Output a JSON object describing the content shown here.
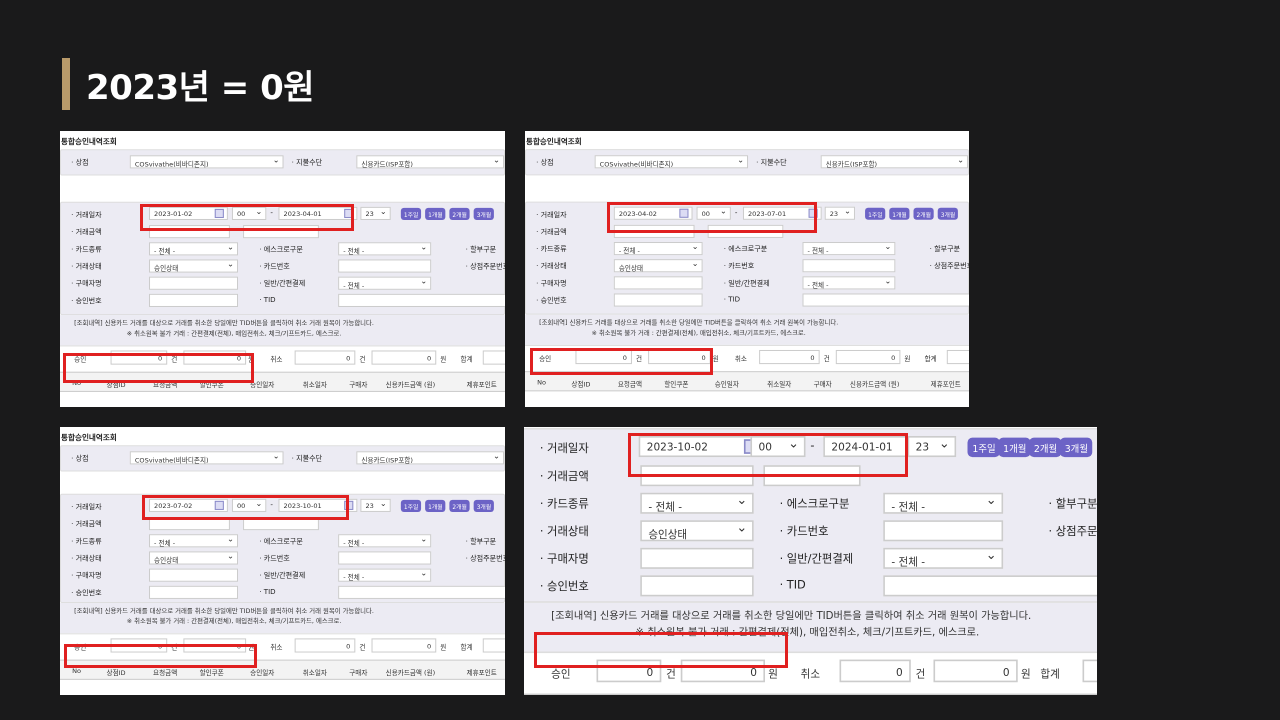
{
  "slide": {
    "title": "2023년 = 0원",
    "accent": "#b89a6a",
    "highlight": "#e02020",
    "button_color": "#6c63c6"
  },
  "form": {
    "screen_title": "통합승인내역조회",
    "store_label": "· 상점",
    "store_value": "COSvivathe(비바디존지)",
    "payment_label": "· 지불수단",
    "payment_value": "신용카드(ISP포함)",
    "date_label": "· 거래일자",
    "amount_label": "· 거래금액",
    "card_type_label": "· 카드종류",
    "card_type_value": "- 전체 -",
    "escrow_label": "· 에스크로구분",
    "escrow_value": "- 전체 -",
    "installment_label": "· 할부구분",
    "status_label": "· 거래상태",
    "status_value": "승인상태",
    "card_no_label": "· 카드번호",
    "store_order_label": "· 상점주문번호",
    "buyer_label": "· 구매자명",
    "simple_pay_label": "· 일반/간편결제",
    "simple_pay_value": "- 전체 -",
    "approval_no_label": "· 승인번호",
    "tid_label": "· TID",
    "range_buttons": [
      "1주일",
      "1개월",
      "2개월",
      "3개월"
    ],
    "notice_line1": "[조회내역]  신용카드 거래를 대상으로 거래를 취소한 당일에만 TID버튼을 클릭하여 취소 거래 원복이 가능합니다.",
    "notice_line2": "※ 취소원복 불가 거래 : 간편결제(전체), 매입전취소, 체크/기프트카드, 에스크로.",
    "approve_label": "승인",
    "cancel_label": "취소",
    "total_label": "합계",
    "count_value": "0",
    "count_unit": "건",
    "amount_value": "0",
    "amount_unit": "원",
    "columns": [
      "No",
      "상점ID",
      "요청금액",
      "할인쿠폰",
      "승인일자",
      "취소일자",
      "구매자",
      "신용카드금액 (원)",
      "제휴포인트"
    ]
  },
  "screens": [
    {
      "start_date": "2023-01-02",
      "start_hour": "00",
      "end_date": "2023-04-01",
      "end_hour": "23"
    },
    {
      "start_date": "2023-04-02",
      "start_hour": "00",
      "end_date": "2023-07-01",
      "end_hour": "23"
    },
    {
      "start_date": "2023-07-02",
      "start_hour": "00",
      "end_date": "2023-10-01",
      "end_hour": "23"
    },
    {
      "start_date": "2023-10-02",
      "start_hour": "00",
      "end_date": "2024-01-01",
      "end_hour": "23"
    }
  ]
}
